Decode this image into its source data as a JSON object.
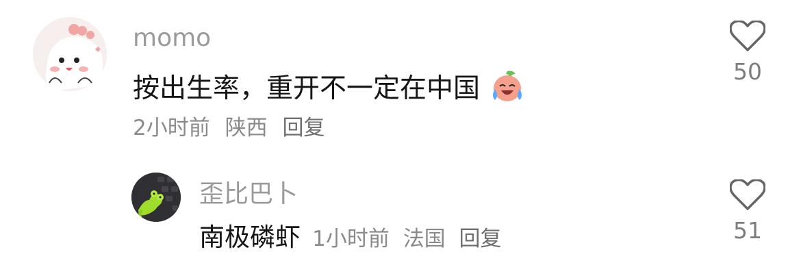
{
  "comments": [
    {
      "username": "momo",
      "text": "按出生率，重开不一定在中国",
      "emoji": "crying-laugh-peach-emoji",
      "time": "2小时前",
      "location": "陕西",
      "reply_label": "回复",
      "likes": "50"
    }
  ],
  "reply": {
    "username": "歪比巴卜",
    "text": "南极磷虾",
    "time": "1小时前",
    "location": "法国",
    "reply_label": "回复",
    "likes": "51"
  },
  "icons": {
    "like": "heart-outline-icon",
    "avatar_main": "pink-cartoon-avatar",
    "avatar_reply": "green-frog-plush-avatar"
  },
  "colors": {
    "text_primary": "#161616",
    "text_secondary": "#9a9a9a",
    "meta": "#8a8a8a",
    "icon": "#666666"
  }
}
